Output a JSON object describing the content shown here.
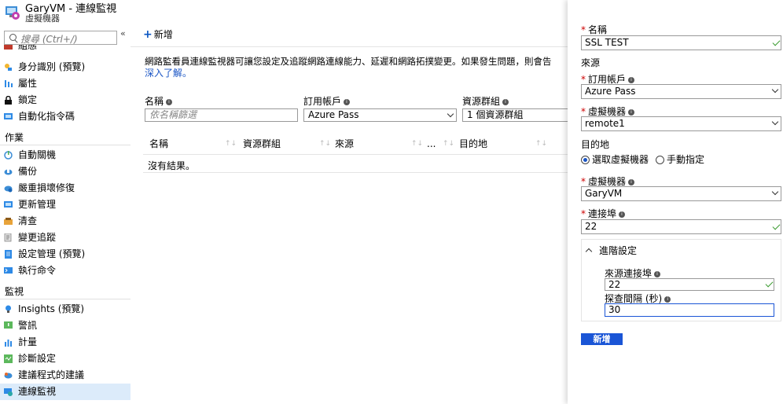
{
  "header": {
    "title": "GaryVM - 連線監視",
    "subtitle": "虛擬機器"
  },
  "sidebar": {
    "search_placeholder": "搜尋 (Ctrl+/)",
    "collapse_glyph": "«",
    "top_items": [
      {
        "label": "組態",
        "icon": "config-icon"
      },
      {
        "label": "身分識別 (預覽)",
        "icon": "identity-icon"
      },
      {
        "label": "屬性",
        "icon": "properties-icon"
      },
      {
        "label": "鎖定",
        "icon": "lock-icon"
      },
      {
        "label": "自動化指令碼",
        "icon": "automation-script-icon"
      }
    ],
    "section_ops": "作業",
    "ops_items": [
      {
        "label": "自動關機",
        "icon": "auto-shutdown-icon"
      },
      {
        "label": "備份",
        "icon": "backup-icon"
      },
      {
        "label": "嚴重損壞修復",
        "icon": "disaster-recovery-icon"
      },
      {
        "label": "更新管理",
        "icon": "update-management-icon"
      },
      {
        "label": "清查",
        "icon": "inventory-icon"
      },
      {
        "label": "變更追蹤",
        "icon": "change-tracking-icon"
      },
      {
        "label": "設定管理 (預覽)",
        "icon": "configuration-management-icon"
      },
      {
        "label": "執行命令",
        "icon": "run-command-icon"
      }
    ],
    "section_monitor": "監視",
    "monitor_items": [
      {
        "label": "Insights (預覽)",
        "icon": "insights-icon"
      },
      {
        "label": "警訊",
        "icon": "alerts-icon"
      },
      {
        "label": "計量",
        "icon": "metrics-icon"
      },
      {
        "label": "診斷設定",
        "icon": "diagnostics-icon"
      },
      {
        "label": "建議程式的建議",
        "icon": "advisor-icon"
      },
      {
        "label": "連線監視",
        "icon": "connection-monitor-icon"
      }
    ]
  },
  "main": {
    "add_label": "新增",
    "description": "網路監看員連線監視器可讓您設定及追蹤網路連線能力、延遲和網路拓撲變更。如果發生問題，則會告",
    "learn_more": "深入了解。",
    "filters": {
      "name_label": "名稱",
      "name_placeholder": "依名稱篩選",
      "subscription_label": "訂用帳戶",
      "subscription_value": "Azure Pass",
      "resource_group_label": "資源群組",
      "resource_group_value": "1 個資源群組"
    },
    "columns": [
      "名稱",
      "資源群組",
      "來源",
      "...",
      "目的地"
    ],
    "empty_text": "沒有結果。"
  },
  "panel": {
    "name_label": "名稱",
    "name_value": "SSL TEST",
    "source_heading": "來源",
    "subscription_label": "訂用帳戶",
    "subscription_value": "Azure Pass",
    "source_vm_label": "虛擬機器",
    "source_vm_value": "remote1",
    "destination_heading": "目的地",
    "radio_select_vm": "選取虛擬機器",
    "radio_manual": "手動指定",
    "dest_vm_label": "虛擬機器",
    "dest_vm_value": "GaryVM",
    "port_label": "連接埠",
    "port_value": "22",
    "advanced_label": "進階設定",
    "source_port_label": "來源連接埠",
    "source_port_value": "22",
    "probe_interval_label": "探查間隔 (秒)",
    "probe_interval_value": "30",
    "submit_label": "新增",
    "accent_color": "#1a55d6",
    "required_color": "#cc0000",
    "valid_color": "#3a9b2f"
  }
}
